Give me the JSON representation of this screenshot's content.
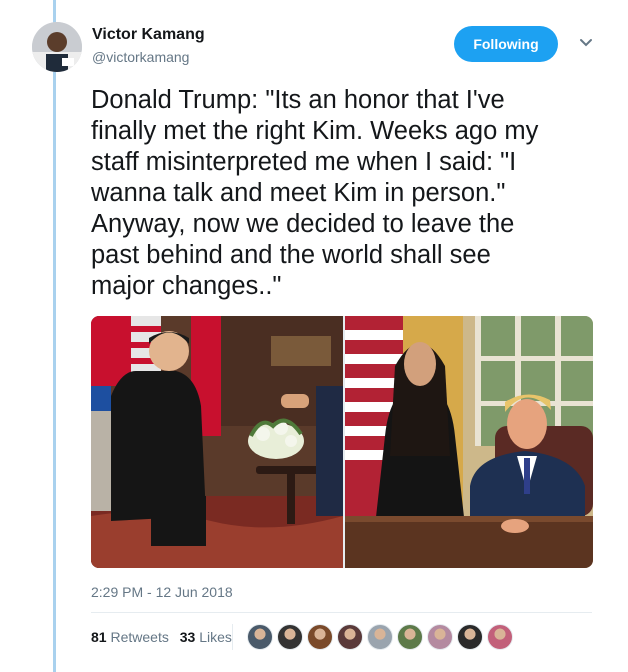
{
  "author": {
    "name": "Victor Kamang",
    "handle": "@victorkamang"
  },
  "follow_button": {
    "label": "Following"
  },
  "tweet": {
    "text": "Donald Trump: \"Its an honor that I've\nfinally met the right Kim. Weeks ago my\nstaff misinterpreted me when I said: \"I\nwanna talk and meet Kim in person.\"\nAnyway, now we decided to leave the\npast behind and the world shall see\nmajor changes..\"",
    "timestamp": "2:29 PM - 12 Jun 2018"
  },
  "stats": {
    "retweets_count": "81",
    "retweets_label": "Retweets",
    "likes_count": "33",
    "likes_label": "Likes"
  },
  "icons": {
    "more": "chevron-down-icon"
  },
  "colors": {
    "accent": "#1da1f2",
    "secondary_text": "#657786",
    "rule": "#a9d1ee"
  },
  "liker_avatars": [
    {
      "color": "#4a5a6a"
    },
    {
      "color": "#333333"
    },
    {
      "color": "#7a4a2a"
    },
    {
      "color": "#5a3a3a"
    },
    {
      "color": "#9aa4ae"
    },
    {
      "color": "#5d7a4a"
    },
    {
      "color": "#b48aa0"
    },
    {
      "color": "#2a2a2a"
    },
    {
      "color": "#c2607a"
    }
  ]
}
